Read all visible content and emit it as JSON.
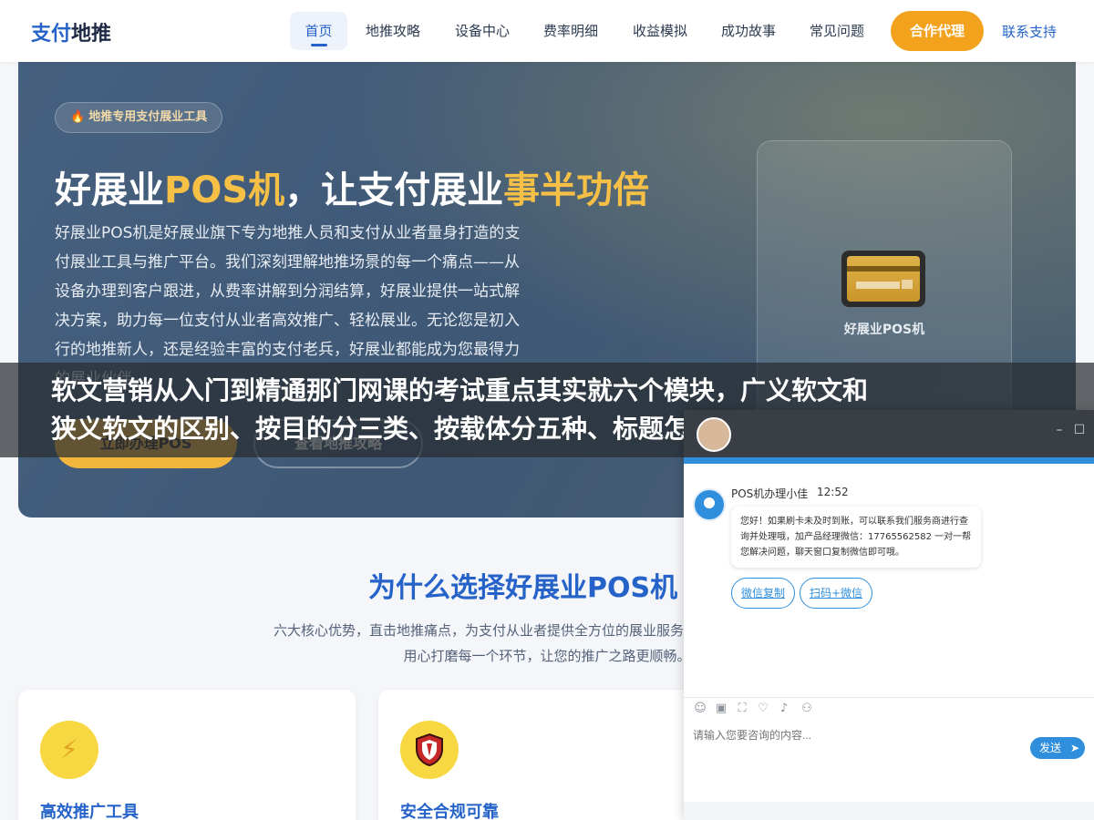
{
  "nav": {
    "logo_pay": "支付",
    "logo_push": "地推",
    "items": [
      "首页",
      "地推攻略",
      "设备中心",
      "费率明细",
      "收益模拟",
      "成功故事",
      "常见问题"
    ],
    "agent_button": "合作代理",
    "support_link": "联系支持"
  },
  "hero": {
    "badge": "地推专用支付展业工具",
    "title_part1": "好展业",
    "title_pos": "POS机",
    "title_part2": "，让支付展业",
    "title_gold": "事半功倍",
    "description": "好展业POS机是好展业旗下专为地推人员和支付从业者量身打造的支付展业工具与推广平台。我们深刻理解地推场景的每一个痛点——从设备办理到客户跟进，从费率讲解到分润结算，好展业提供一站式解决方案，助力每一位支付从业者高效推广、轻松展业。无论您是初入行的地推新人，还是经验丰富的支付老兵，好展业都能成为您最得力的展业伙伴。",
    "primary_button": "立即办理POS",
    "secondary_button": "查看地推攻略",
    "card_label": "好展业POS机"
  },
  "section": {
    "title": "为什么选择好展业POS机",
    "description": "六大核心优势，直击地推痛点，为支付从业者提供全方位的展业服务，从培训到收益，我们用心打磨每一个环节，让您的推广之路更顺畅。"
  },
  "features": [
    {
      "icon": "lightning-icon",
      "title": "高效推广工具"
    },
    {
      "icon": "shield-icon",
      "title": "安全合规可靠"
    }
  ],
  "banner": {
    "line1": "软文营销从入门到精通那门网课的考试重点其实就六个模块，广义软文和",
    "line2": "狭义软文的区别、按目的分三类、按载体分五种、标题怎么起、正文怎么"
  },
  "chat": {
    "agent_name": "POS机办理小佳",
    "time": "12:52",
    "message": "您好！如果刷卡未及时到账，可以联系我们服务商进行查询并处理哦，加产品经理微信：17765562582 一对一帮您解决问题，聊天窗口复制微信即可哦。",
    "quick_replies": [
      "微信复制",
      "扫码+微信"
    ],
    "input_placeholder": "请输入您要咨询的内容...",
    "send_label": "发送"
  },
  "colors": {
    "brand_blue": "#2563c9",
    "accent_orange": "#f2a21c",
    "gold": "#f6c046",
    "chat_blue": "#2f8fdc"
  }
}
